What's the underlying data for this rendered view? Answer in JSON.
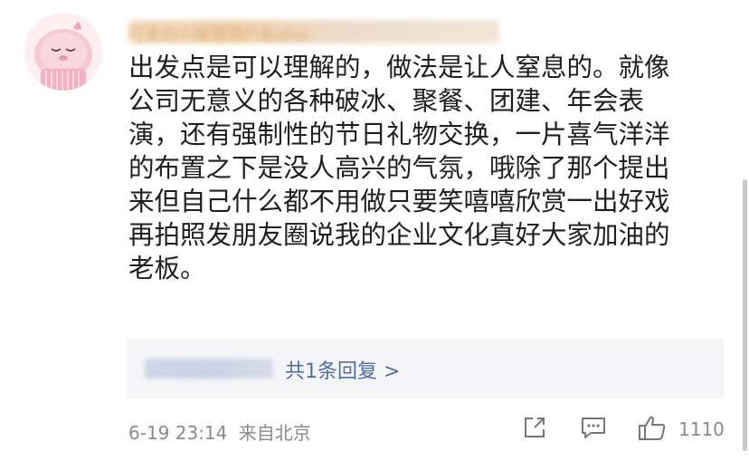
{
  "comment": {
    "username": "可爱的小猪猪用户名ahai",
    "lines": [
      "出发点是可以理解的，做法是让人窒息的。就像",
      "公司无意义的各种破冰、聚餐、团建、年会表",
      "演，还有强制性的节日礼物交换，一片喜气洋洋",
      "的布置之下是没人高兴的气氛，哦除了那个提出",
      "来但自己什么都不用做只要笑嘻嘻欣赏一出好戏",
      "再拍照发朋友圈说我的企业文化真好大家加油的",
      "老板。"
    ]
  },
  "reply": {
    "link_text": "共1条回复 >"
  },
  "meta": {
    "time": "6-19 23:14",
    "source": "来自北京",
    "like_count": "1110"
  },
  "icons": {
    "avatar": "pink-pig-avatar",
    "more": "more-dots-icon",
    "share": "share-icon",
    "comment": "comment-icon",
    "like": "thumbs-up-icon"
  },
  "colors": {
    "text": "#1f1f1f",
    "link": "#4e6fa6",
    "muted": "#8a8a8a",
    "reply_bg": "#f5f5f7"
  }
}
